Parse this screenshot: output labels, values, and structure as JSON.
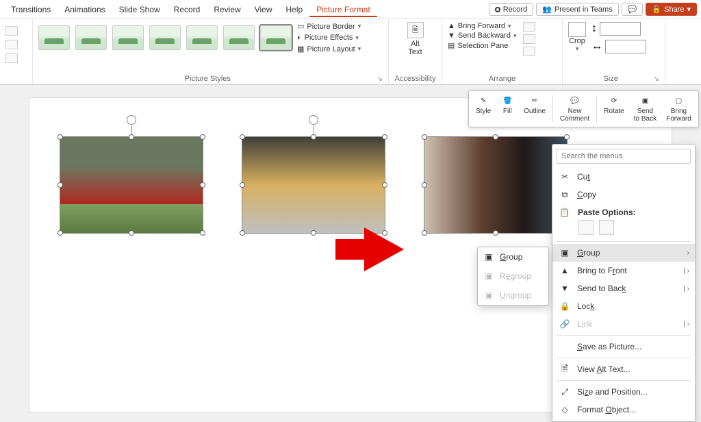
{
  "tabs": {
    "transitions": "Transitions",
    "animations": "Animations",
    "slideshow": "Slide Show",
    "record": "Record",
    "review": "Review",
    "view": "View",
    "help": "Help",
    "picture_format": "Picture Format"
  },
  "titlebuttons": {
    "record": "Record",
    "present_teams": "Present in Teams",
    "share": "Share"
  },
  "ribbon": {
    "styles_label": "Picture Styles",
    "border": "Picture Border",
    "effects": "Picture Effects",
    "layout": "Picture Layout",
    "accessibility_label": "Accessibility",
    "alt_text": "Alt\nText",
    "arrange_label": "Arrange",
    "bring_forward": "Bring Forward",
    "send_backward": "Send Backward",
    "selection_pane": "Selection Pane",
    "size_label": "Size",
    "crop": "Crop",
    "height_value": "",
    "width_value": ""
  },
  "minitb": {
    "style": "Style",
    "fill": "Fill",
    "outline": "Outline",
    "new_comment": "New\nComment",
    "rotate": "Rotate",
    "send_back": "Send\nto Back",
    "bring_forward": "Bring\nForward"
  },
  "context": {
    "search_placeholder": "Search the menus",
    "cut": "Cut",
    "copy": "Copy",
    "paste_options": "Paste Options:",
    "group": "Group",
    "bring_to_front": "Bring to Front",
    "send_to_back": "Send to Back",
    "lock": "Lock",
    "link": "Link",
    "save_as_picture": "Save as Picture...",
    "view_alt_text": "View Alt Text...",
    "size_and_position": "Size and Position...",
    "format_object": "Format Object..."
  },
  "submenu": {
    "group": "Group",
    "regroup": "Regroup",
    "ungroup": "Ungroup"
  }
}
